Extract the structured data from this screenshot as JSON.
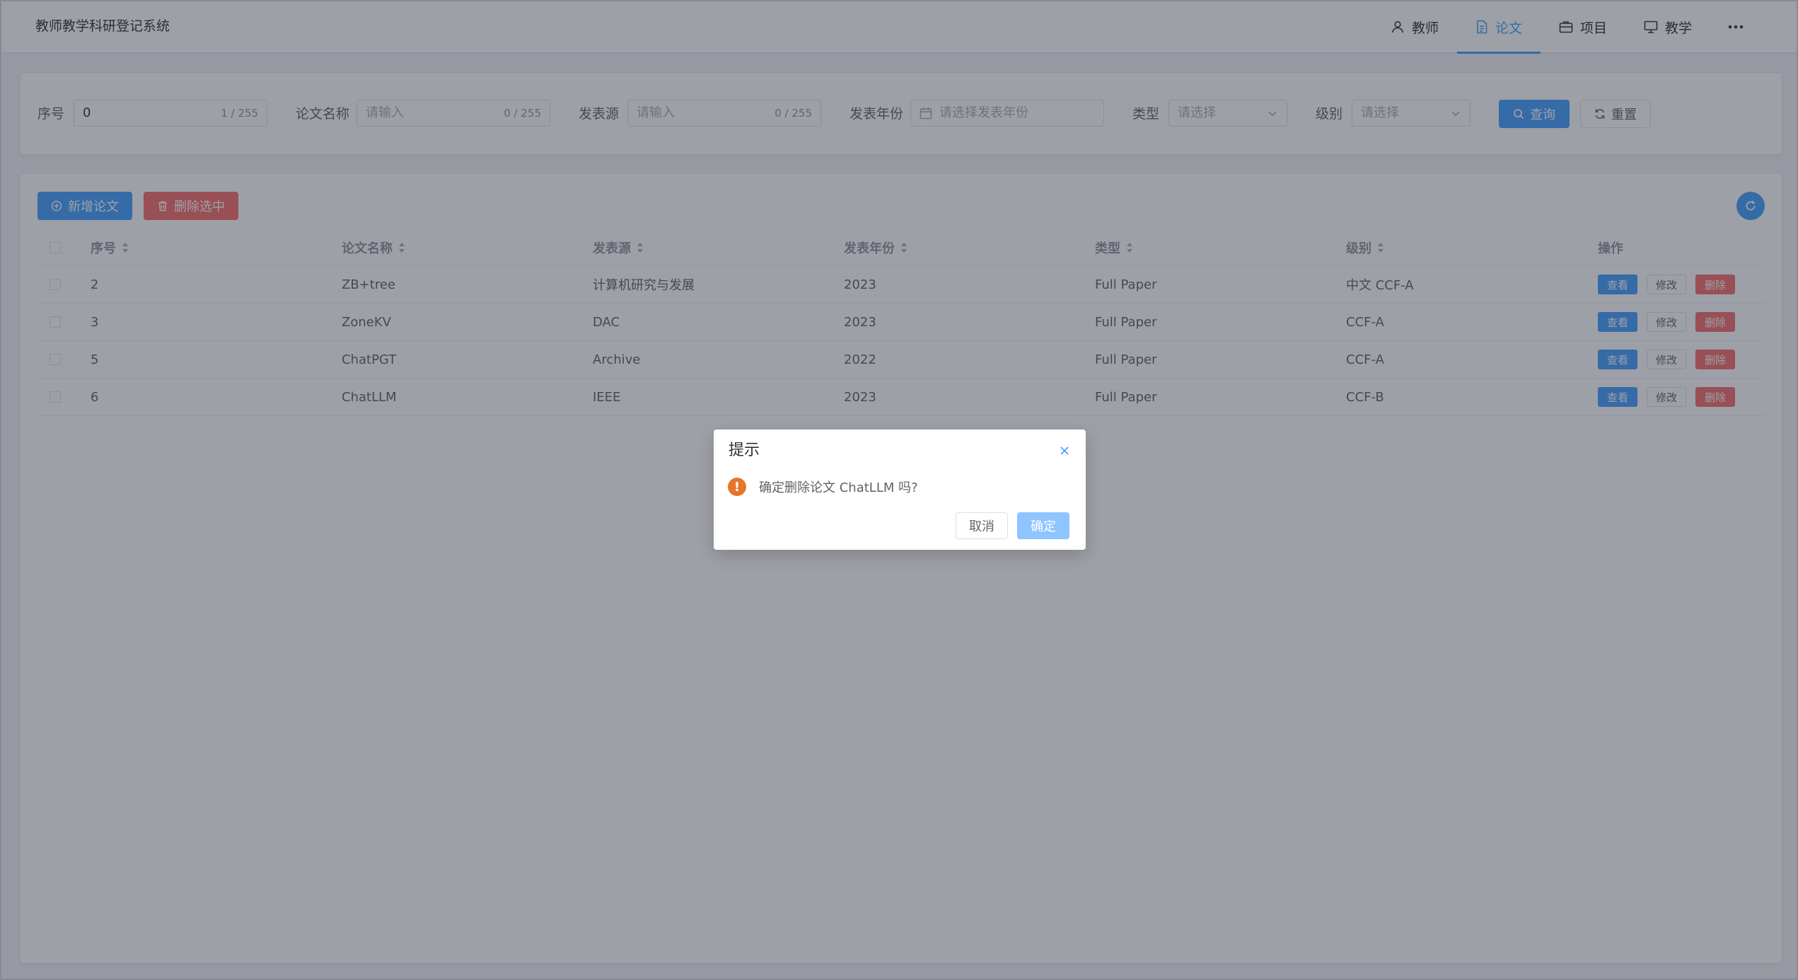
{
  "app": {
    "title": "教师教学科研登记系统"
  },
  "nav": {
    "items": [
      {
        "label": "教师",
        "icon": "user-icon"
      },
      {
        "label": "论文",
        "icon": "document-icon",
        "active": true
      },
      {
        "label": "项目",
        "icon": "briefcase-icon"
      },
      {
        "label": "教学",
        "icon": "monitor-icon"
      }
    ],
    "more_icon": "more-icon"
  },
  "search": {
    "id_label": "序号",
    "id_value": "0",
    "id_counter": "1 / 255",
    "name_label": "论文名称",
    "name_placeholder": "请输入",
    "name_counter": "0 / 255",
    "source_label": "发表源",
    "source_placeholder": "请输入",
    "source_counter": "0 / 255",
    "year_label": "发表年份",
    "year_placeholder": "请选择发表年份",
    "type_label": "类型",
    "type_placeholder": "请选择",
    "level_label": "级别",
    "level_placeholder": "请选择",
    "query_label": "查询",
    "reset_label": "重置"
  },
  "toolbar": {
    "add_label": "新增论文",
    "delete_selected_label": "删除选中"
  },
  "table": {
    "columns": [
      "序号",
      "论文名称",
      "发表源",
      "发表年份",
      "类型",
      "级别",
      "操作"
    ],
    "rows": [
      {
        "id": "2",
        "name": "ZB+tree",
        "source": "计算机研究与发展",
        "year": "2023",
        "type": "Full Paper",
        "level": "中文 CCF-A"
      },
      {
        "id": "3",
        "name": "ZoneKV",
        "source": "DAC",
        "year": "2023",
        "type": "Full Paper",
        "level": "CCF-A"
      },
      {
        "id": "5",
        "name": "ChatPGT",
        "source": "Archive",
        "year": "2022",
        "type": "Full Paper",
        "level": "CCF-A"
      },
      {
        "id": "6",
        "name": "ChatLLM",
        "source": "IEEE",
        "year": "2023",
        "type": "Full Paper",
        "level": "CCF-B"
      }
    ],
    "actions": {
      "view": "查看",
      "edit": "修改",
      "delete": "删除"
    }
  },
  "dialog": {
    "title": "提示",
    "message": "确定删除论文 ChatLLM 吗?",
    "cancel_label": "取消",
    "confirm_label": "确定",
    "icon": "warning-icon",
    "icon_glyph": "!"
  },
  "colors": {
    "primary": "#409eff",
    "danger": "#f56c6c",
    "warning": "#e6762a"
  }
}
